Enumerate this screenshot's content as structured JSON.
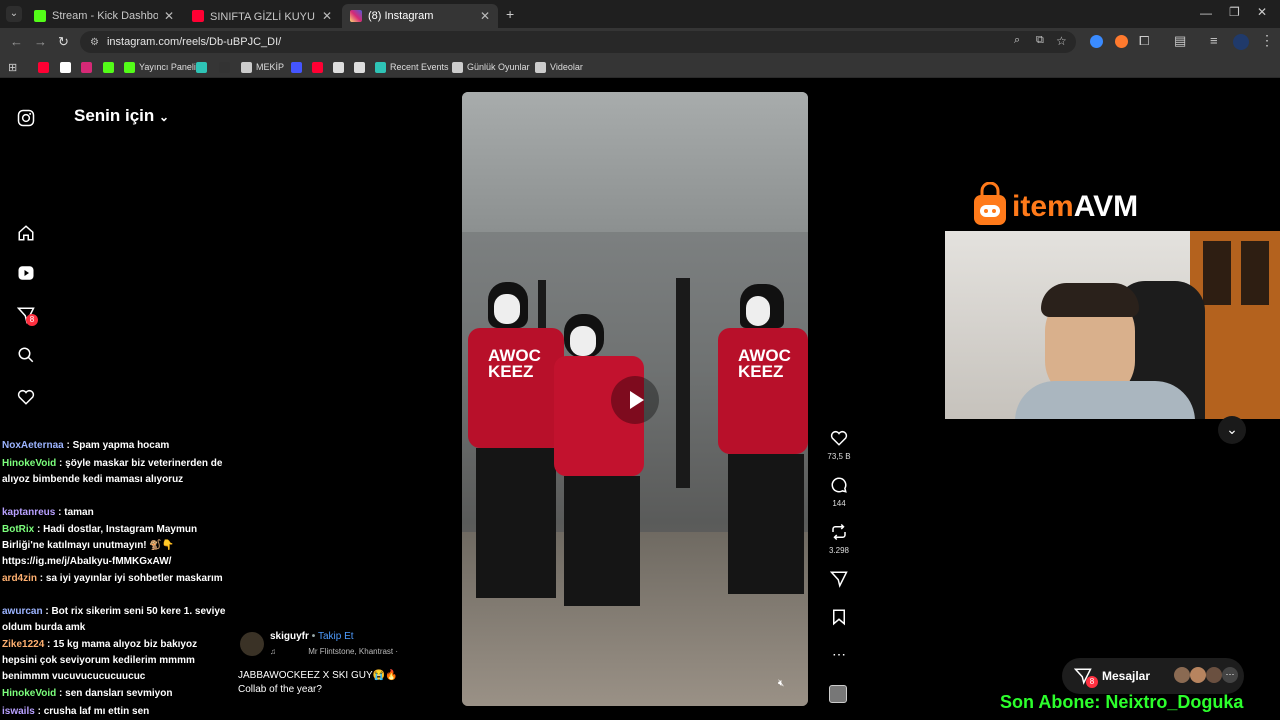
{
  "browser": {
    "tabs": [
      {
        "title": "Stream - Kick Dashboard",
        "favicon_color": "#53fc18",
        "active": false
      },
      {
        "title": "SINIFTA GİZLİ KUYU BULDUK! 🤔",
        "favicon_color": "#ff0033",
        "active": false
      },
      {
        "title": "(8) Instagram",
        "favicon_color": "#d62976",
        "active": true
      }
    ],
    "url": "instagram.com/reels/Db-uBPJC_DI/",
    "bookmarks": [
      {
        "label": "",
        "icon": "youtube-icon",
        "color": "#ff0033"
      },
      {
        "label": "",
        "icon": "x-icon",
        "color": "#ffffff"
      },
      {
        "label": "",
        "icon": "instagram-icon",
        "color": "#d62976"
      },
      {
        "label": "",
        "icon": "kick-icon",
        "color": "#53fc18"
      },
      {
        "label": "Yayıncı Paneli",
        "icon": "kick-icon",
        "color": "#53fc18"
      },
      {
        "label": "",
        "icon": "app-icon",
        "color": "#2ec4b6"
      },
      {
        "label": "",
        "icon": "terminal-icon",
        "color": "#333"
      },
      {
        "label": "MEKİP",
        "icon": "folder-icon",
        "color": "#ccc"
      },
      {
        "label": "",
        "icon": "app-icon",
        "color": "#4455ff"
      },
      {
        "label": "",
        "icon": "youtube-icon",
        "color": "#ff0033"
      },
      {
        "label": "",
        "icon": "image-icon",
        "color": "#ddd"
      },
      {
        "label": "",
        "icon": "app-icon",
        "color": "#ddd"
      },
      {
        "label": "Recent Events",
        "icon": "app-icon",
        "color": "#2ec4b6"
      },
      {
        "label": "Günlük Oyunlar",
        "icon": "folder-icon",
        "color": "#ccc"
      },
      {
        "label": "Videolar",
        "icon": "folder-icon",
        "color": "#ccc"
      }
    ]
  },
  "instagram": {
    "feed_title": "Senin için",
    "notification_count": "8",
    "reel": {
      "author": "skiguyfr",
      "follow_label": "Takip Et",
      "audio": "Mr Flintstone, Khantrast ·",
      "caption_line1": "JABBAWOCKEEZ X SKI GUY😭🔥",
      "caption_line2": "Collab of the year?",
      "shirt_text": "AWOC KEEZ"
    },
    "actions": {
      "likes": "73,5 B",
      "comments": "144",
      "reposts": "3.298"
    },
    "messages_label": "Mesajlar",
    "messages_badge": "8"
  },
  "overlay": {
    "sponsor_prefix": "item",
    "sponsor_suffix": "AVM",
    "last_sub": "Son Abone: Neixtro_Doguka"
  },
  "chat": [
    {
      "user": "NoxAeternaa",
      "color": "#9cb4ff",
      "text": " : Spam yapma hocam"
    },
    {
      "user": "HinokeVoid",
      "color": "#7cff7c",
      "text": " : şöyle maskar biz veterinerden de alıyoz bimbende kedi maması alıyoruz"
    },
    {
      "user": "kaptanreus",
      "color": "#b8a0ff",
      "text": " : taman"
    },
    {
      "user": "BotRix",
      "color": "#7cff7c",
      "text": " : Hadi dostlar, Instagram Maymun Birliği'ne katılmayı unutmayın! 🐒👇 https://ig.me/j/AbaIkyu-fMMKGxAW/"
    },
    {
      "user": "ard4zin",
      "color": "#ffb070",
      "text": " : sa iyi yayınlar iyi sohbetler maskarım"
    },
    {
      "user": "awurcan",
      "color": "#9cb4ff",
      "text": " : Bot rix sikerim seni 50 kere 1. seviye oldum burda amk"
    },
    {
      "user": "Zike1224",
      "color": "#ffb070",
      "text": " : 15 kg mama alıyoz biz bakıyoz hepsini çok seviyorum kedilerim mmmm benimmm vucuvucucucuucuc"
    },
    {
      "user": "HinokeVoid",
      "color": "#7cff7c",
      "text": " : sen dansları sevmiyon"
    },
    {
      "user": "iswails",
      "color": "#b8a0ff",
      "text": " : crusha laf mı ettin sen"
    }
  ]
}
